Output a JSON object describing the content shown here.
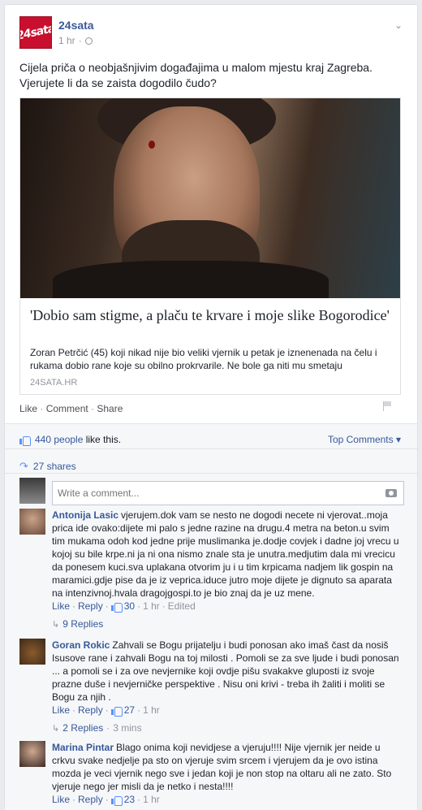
{
  "post": {
    "page_name": "24sata",
    "logo_text": "24sata",
    "time": "1 hr",
    "text": "Cijela priča o neobjašnjivim događajima u malom mjestu kraj Zagreba. Vjerujete li da se zaista dogodilo čudo?",
    "share": {
      "title": "'Dobio sam stigme, a plaču te krvare i moje slike Bogorodice'",
      "description": "Zoran Petrčić (45) koji nikad nije bio veliki vjernik u petak je iznenenada na čelu i rukama dobio rane koje su obilno prokrvarile. Ne bole ga niti mu smetaju",
      "domain": "24SATA.HR"
    },
    "actions": {
      "like": "Like",
      "comment": "Comment",
      "share": "Share",
      "sep": " · "
    }
  },
  "summary": {
    "likes_link": "440 people",
    "likes_suffix": " like this.",
    "top_comments": "Top Comments ▾",
    "shares": "27 shares"
  },
  "composer": {
    "placeholder": "Write a comment..."
  },
  "comments": [
    {
      "author": "Antonija Lasic",
      "text": "vjerujem.dok vam se nesto ne dogodi necete ni vjerovat..moja prica ide ovako:dijete mi palo s jedne razine na drugu.4 metra na beton.u svim tim mukama odoh kod jedne prije muslimanka je.dodje covjek i dadne joj vrecu u kojoj su bile krpe.ni ja ni ona nismo znale sta je unutra.medjutim dala mi vrecicu da ponesem kuci.sva uplakana otvorim ju i u tim krpicama nadjem lik gospin na maramici.gdje pise da je iz veprica.iduce jutro moje dijete je dignuto sa aparata na intenzivnoj.hvala dragojgospi.to je bio znaj da je uz mene.",
      "like": "Like",
      "reply": "Reply",
      "likes": "30",
      "time": "1 hr",
      "edited": "Edited",
      "replies": "9 Replies"
    },
    {
      "author": "Goran Rokic",
      "text": "Zahvali se Bogu prijatelju i budi ponosan ako imaš čast da nosiš Isusove rane i zahvali Bogu na toj milosti . Pomoli se za sve ljude i budi ponosan ... a pomoli se i za ove nevjernike koji ovdje pišu svakakve gluposti iz svoje prazne duše i nevjerničke perspektive . Nisu oni krivi - treba ih žaliti i moliti se Bogu za njih .",
      "like": "Like",
      "reply": "Reply",
      "likes": "27",
      "time": "1 hr",
      "replies": "2 Replies",
      "replies_time": "3 mins"
    },
    {
      "author": "Marina Pintar",
      "text": "Blago onima koji nevidjese a vjeruju!!!! Nije vjernik jer neide u crkvu svake nedjelje pa sto on vjeruje svim srcem i vjerujem da je ovo istina mozda je veci vjernik nego sve i jedan koji je non stop na oltaru ali ne zato. Sto vjeruje nego jer misli da je netko i nesta!!!!",
      "like": "Like",
      "reply": "Reply",
      "likes": "23",
      "time": "1 hr"
    }
  ]
}
